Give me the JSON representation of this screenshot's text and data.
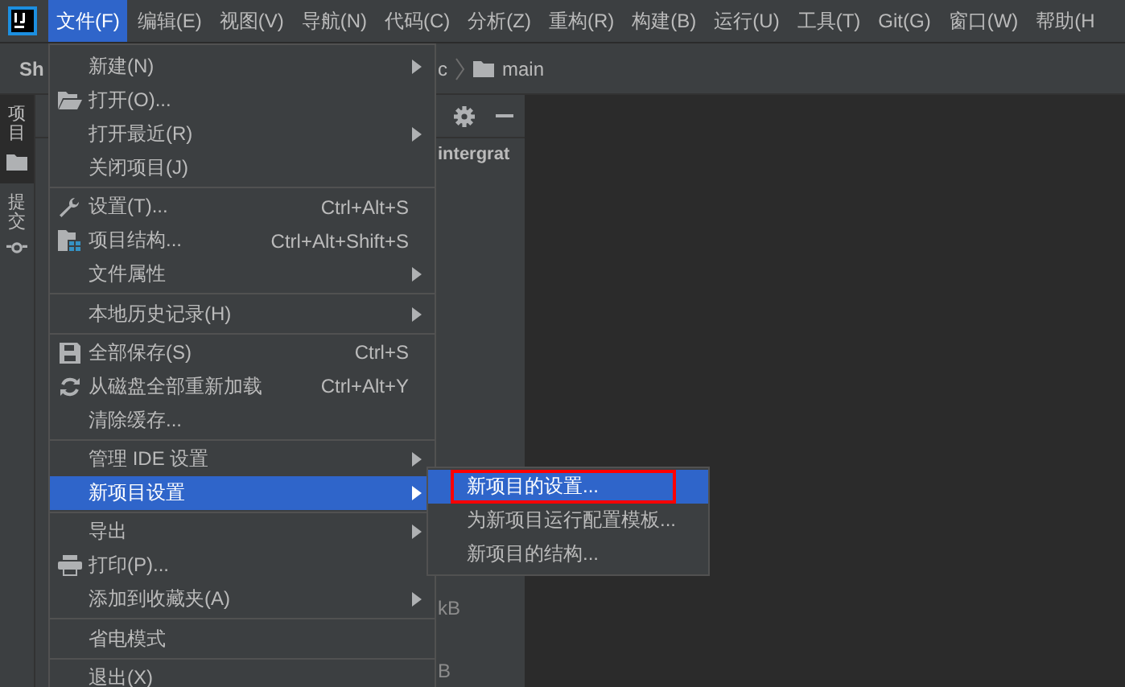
{
  "menubar": [
    {
      "label": "文件(F)",
      "selected": true
    },
    {
      "label": "编辑(E)",
      "selected": false
    },
    {
      "label": "视图(V)",
      "selected": false
    },
    {
      "label": "导航(N)",
      "selected": false
    },
    {
      "label": "代码(C)",
      "selected": false
    },
    {
      "label": "分析(Z)",
      "selected": false
    },
    {
      "label": "重构(R)",
      "selected": false
    },
    {
      "label": "构建(B)",
      "selected": false
    },
    {
      "label": "运行(U)",
      "selected": false
    },
    {
      "label": "工具(T)",
      "selected": false
    },
    {
      "label": "Git(G)",
      "selected": false
    },
    {
      "label": "窗口(W)",
      "selected": false
    },
    {
      "label": "帮助(H",
      "selected": false
    }
  ],
  "navbar": {
    "project": "Sh",
    "breadcrumb": [
      "c",
      "main"
    ]
  },
  "side_tabs": [
    {
      "label": "项目",
      "selected": true
    },
    {
      "label": "提交",
      "selected": false
    }
  ],
  "project_tree": [
    {
      "text": "intergrat",
      "kind": "bold"
    },
    {
      "text": "kB",
      "kind": "plain"
    },
    {
      "text": "B",
      "kind": "plain"
    }
  ],
  "file_menu": [
    {
      "kind": "item",
      "label": "新建(N)",
      "submenu": true,
      "selected": false
    },
    {
      "kind": "item",
      "label": "打开(O)...",
      "selected": false
    },
    {
      "kind": "item",
      "label": "打开最近(R)",
      "submenu": true,
      "selected": false
    },
    {
      "kind": "item",
      "label": "关闭项目(J)",
      "selected": false
    },
    {
      "kind": "separator"
    },
    {
      "kind": "item",
      "label": "设置(T)...",
      "shortcut": "Ctrl+Alt+S",
      "selected": false
    },
    {
      "kind": "item",
      "label": "项目结构...",
      "shortcut": "Ctrl+Alt+Shift+S",
      "selected": false
    },
    {
      "kind": "item",
      "label": "文件属性",
      "submenu": true,
      "selected": false
    },
    {
      "kind": "separator"
    },
    {
      "kind": "item",
      "label": "本地历史记录(H)",
      "submenu": true,
      "selected": false
    },
    {
      "kind": "separator"
    },
    {
      "kind": "item",
      "label": "全部保存(S)",
      "shortcut": "Ctrl+S",
      "selected": false
    },
    {
      "kind": "item",
      "label": "从磁盘全部重新加载",
      "shortcut": "Ctrl+Alt+Y",
      "selected": false
    },
    {
      "kind": "item",
      "label": "清除缓存...",
      "selected": false
    },
    {
      "kind": "separator"
    },
    {
      "kind": "item",
      "label": "管理 IDE 设置",
      "submenu": true,
      "selected": false
    },
    {
      "kind": "item",
      "label": "新项目设置",
      "submenu": true,
      "selected": true
    },
    {
      "kind": "separator"
    },
    {
      "kind": "item",
      "label": "导出",
      "submenu": true,
      "selected": false
    },
    {
      "kind": "item",
      "label": "打印(P)...",
      "selected": false
    },
    {
      "kind": "item",
      "label": "添加到收藏夹(A)",
      "submenu": true,
      "selected": false
    },
    {
      "kind": "separator"
    },
    {
      "kind": "item",
      "label": "省电模式",
      "selected": false
    },
    {
      "kind": "separator"
    },
    {
      "kind": "item",
      "label": "退出(X)",
      "selected": false
    }
  ],
  "submenu": [
    {
      "label": "新项目的设置...",
      "selected": true,
      "annotated": true
    },
    {
      "label": "为新项目运行配置模板...",
      "selected": false,
      "annotated": false
    },
    {
      "label": "新项目的结构...",
      "selected": false,
      "annotated": false
    }
  ]
}
